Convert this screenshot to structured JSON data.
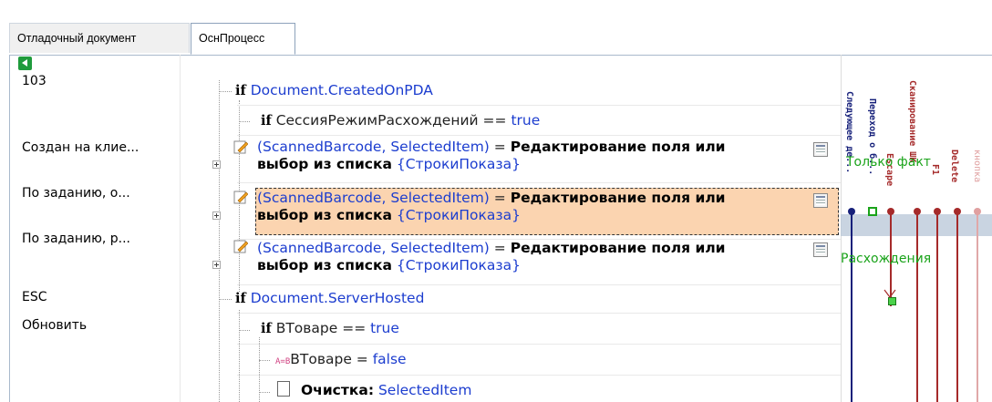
{
  "tabs": [
    {
      "label": "Отладочный документ"
    },
    {
      "label": "ОснПроцесс"
    }
  ],
  "left_labels": [
    "103",
    "Создан на клие...",
    "По заданию, о...",
    "По заданию, р...",
    "ESC",
    "Обновить"
  ],
  "tree": {
    "row1": {
      "keyword": "if",
      "object": "Document",
      "rest": ".CreatedOnPDA"
    },
    "row2": {
      "keyword": "if",
      "text": "СессияРежимРасхождений == ",
      "value": "true"
    },
    "action_rows": [
      {
        "params": "(ScannedBarcode, SelectedItem)",
        "eq": " = ",
        "title_line1": "Редактирование поля или",
        "title_line2": "выбор из списка",
        "arg": "{СтрокиПоказа}"
      },
      {
        "params": "(ScannedBarcode, SelectedItem)",
        "eq": " = ",
        "title_line1": "Редактирование поля или",
        "title_line2": "выбор из списка",
        "arg": "{СтрокиПоказа}"
      },
      {
        "params": "(ScannedBarcode, SelectedItem)",
        "eq": " = ",
        "title_line1": "Редактирование поля или",
        "title_line2": "выбор из списка",
        "arg": "{СтрокиПоказа}"
      }
    ],
    "row6": {
      "keyword": "if",
      "object": "Document",
      "rest": ".ServerHosted"
    },
    "row7": {
      "keyword": "if",
      "text": "ВТоваре == ",
      "value": "true"
    },
    "row8": {
      "prefix": "A=B",
      "text": "ВТоваре = ",
      "value": "false"
    },
    "row9": {
      "label": "Очистка:",
      "value": "SelectedItem"
    }
  },
  "diagram": {
    "vertical_labels": [
      "Следующее де...",
      "Переход о б...",
      "Escape",
      "Сканирование ШК",
      "F1",
      "Delete",
      "кнопка"
    ],
    "label_only_fact": "Только факт",
    "label_discrepancy": "Расхождения",
    "colors": {
      "navy": "#16207a",
      "green": "#1aa31a",
      "red": "#a52a2a",
      "selected_band": "#b7c5d7"
    }
  },
  "icons": [
    "back-arrow-icon",
    "pencil-icon",
    "expand-icon",
    "form-icon",
    "assignment-icon",
    "document-icon"
  ]
}
